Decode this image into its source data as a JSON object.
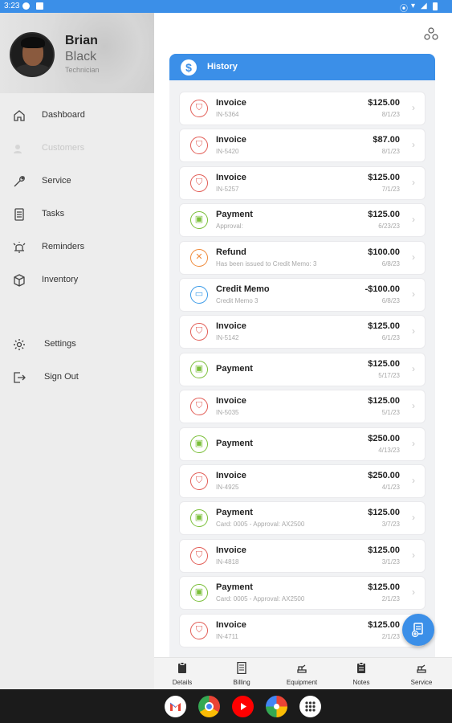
{
  "status_bar": {
    "time": "3:23"
  },
  "profile": {
    "first_name": "Brian",
    "last_name": "Black",
    "role": "Technician"
  },
  "sidebar": {
    "items": [
      {
        "label": "Dashboard",
        "icon": "home-icon"
      },
      {
        "label": "Customers",
        "icon": "customers-icon"
      },
      {
        "label": "Service",
        "icon": "wrench-icon"
      },
      {
        "label": "Tasks",
        "icon": "tasks-icon"
      },
      {
        "label": "Reminders",
        "icon": "alarm-icon"
      },
      {
        "label": "Inventory",
        "icon": "box-icon"
      },
      {
        "label": "Settings",
        "icon": "gear-icon"
      },
      {
        "label": "Sign Out",
        "icon": "sign-out-icon"
      }
    ]
  },
  "history": {
    "title": "History",
    "rows": [
      {
        "type": "invoice",
        "title": "Invoice",
        "subtitle": "IN-5364",
        "amount": "$125.00",
        "date": "8/1/23"
      },
      {
        "type": "invoice",
        "title": "Invoice",
        "subtitle": "IN-5420",
        "amount": "$87.00",
        "date": "8/1/23"
      },
      {
        "type": "invoice",
        "title": "Invoice",
        "subtitle": "IN-5257",
        "amount": "$125.00",
        "date": "7/1/23"
      },
      {
        "type": "payment",
        "title": "Payment",
        "subtitle": "Approval:",
        "amount": "$125.00",
        "date": "6/23/23"
      },
      {
        "type": "refund",
        "title": "Refund",
        "subtitle": "Has been issued to Credit Memo: 3",
        "amount": "$100.00",
        "date": "6/8/23"
      },
      {
        "type": "credit",
        "title": "Credit Memo",
        "subtitle": "Credit Memo 3",
        "amount": "-$100.00",
        "date": "6/8/23"
      },
      {
        "type": "invoice",
        "title": "Invoice",
        "subtitle": "IN-5142",
        "amount": "$125.00",
        "date": "6/1/23"
      },
      {
        "type": "payment",
        "title": "Payment",
        "subtitle": "",
        "amount": "$125.00",
        "date": "5/17/23"
      },
      {
        "type": "invoice",
        "title": "Invoice",
        "subtitle": "IN-5035",
        "amount": "$125.00",
        "date": "5/1/23"
      },
      {
        "type": "payment",
        "title": "Payment",
        "subtitle": "",
        "amount": "$250.00",
        "date": "4/13/23"
      },
      {
        "type": "invoice",
        "title": "Invoice",
        "subtitle": "IN-4925",
        "amount": "$250.00",
        "date": "4/1/23"
      },
      {
        "type": "payment",
        "title": "Payment",
        "subtitle": "Card: 0005 - Approval: AX2500",
        "amount": "$125.00",
        "date": "3/7/23"
      },
      {
        "type": "invoice",
        "title": "Invoice",
        "subtitle": "IN-4818",
        "amount": "$125.00",
        "date": "3/1/23"
      },
      {
        "type": "payment",
        "title": "Payment",
        "subtitle": "Card: 0005 - Approval: AX2500",
        "amount": "$125.00",
        "date": "2/1/23"
      },
      {
        "type": "invoice",
        "title": "Invoice",
        "subtitle": "IN-4711",
        "amount": "$125.00",
        "date": "2/1/23"
      }
    ]
  },
  "tabs": [
    {
      "label": "Details"
    },
    {
      "label": "Billing"
    },
    {
      "label": "Equipment"
    },
    {
      "label": "Notes"
    },
    {
      "label": "Service"
    }
  ],
  "colors": {
    "accent": "#3b8fe8",
    "invoice": "#e25d56",
    "payment": "#7bbf3a",
    "refund": "#ef8a3a",
    "credit": "#3b9be8"
  },
  "launcher_apps": [
    "gmail-icon",
    "chrome-icon",
    "youtube-icon",
    "photos-icon",
    "app-drawer-icon"
  ]
}
